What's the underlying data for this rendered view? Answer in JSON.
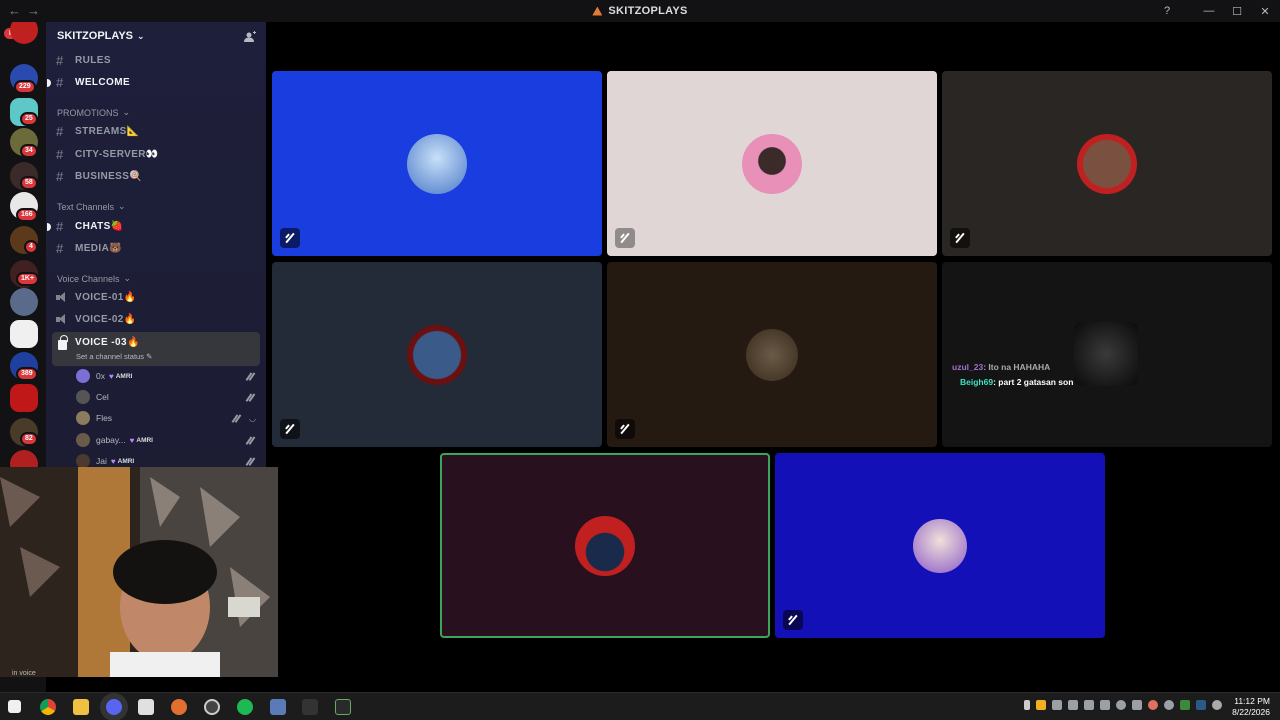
{
  "window": {
    "title": "SKITZOPLAYS",
    "back": "←",
    "forward": "→"
  },
  "servers": {
    "new_badge": "NEW",
    "badges": [
      "229",
      "25",
      "34",
      "58",
      "166",
      "4",
      "1K+",
      "389",
      "82"
    ]
  },
  "guild": {
    "name": "SKITZOPLAYS",
    "top_channels": [
      {
        "name": "RULES"
      },
      {
        "name": "WELCOME"
      }
    ],
    "promotions_label": "PROMOTIONS",
    "promotions": [
      {
        "name": "STREAMS📐"
      },
      {
        "name": "CITY-SERVER👀"
      },
      {
        "name": "BUSINESS🍭"
      }
    ],
    "text_label": "Text Channels",
    "text_channels": [
      {
        "name": "CHATS🍓"
      },
      {
        "name": "MEDIA🐻"
      }
    ],
    "voice_label": "Voice Channels",
    "voice_channels": [
      {
        "name": "VOICE-01🔥"
      },
      {
        "name": "VOICE-02🔥"
      },
      {
        "name": "VOICE -03🔥"
      }
    ],
    "channel_status_placeholder": "Set a channel status",
    "members": [
      {
        "name": "0x",
        "tag": "AMRI",
        "color": "#7b6fd6"
      },
      {
        "name": "Cel",
        "tag": "",
        "color": "#555"
      },
      {
        "name": "Fles",
        "tag": "",
        "color": "#8a7c5c"
      },
      {
        "name": "gabay...",
        "tag": "AMRI",
        "color": "#6a5a4a"
      },
      {
        "name": "Jai",
        "tag": "AMRI",
        "color": "#4a3a30"
      }
    ]
  },
  "stage": {
    "tiles": [
      {
        "bg": "#1a3de0",
        "avatar": "#6fa0e0",
        "muted": true
      },
      {
        "bg": "#e0d6d6",
        "avatar": "#e8a0c0",
        "muted": true
      },
      {
        "bg": "#2a2624",
        "avatar": "#8a5040",
        "muted": true
      },
      {
        "bg": "#232a38",
        "avatar": "#3a5a8a",
        "muted": true
      },
      {
        "bg": "#241a12",
        "avatar": "#6a5a48",
        "muted": true
      },
      {
        "bg": "#141414",
        "avatar": "#2a2a2a",
        "muted": false
      },
      {
        "bg": "#28101e",
        "avatar": "#c02020",
        "muted": false
      },
      {
        "bg": "#1410b8",
        "avatar": "#d8c0e0",
        "muted": true
      }
    ],
    "chat": [
      {
        "user": "uzul_23",
        "sep": ": ",
        "text": "Ito na HAHAHA",
        "color": "#a070d0"
      },
      {
        "user": "Beigh69",
        "sep": ": ",
        "text": "part 2 gatasan son",
        "color": "#40e0c0"
      }
    ]
  },
  "webcam": {
    "overlay_text": "in voice"
  },
  "taskbar": {
    "time": "11:12 PM",
    "date": "8/22/2026"
  },
  "colors": {
    "accent_green": "#3ba55d",
    "mention_red": "#da373c"
  }
}
